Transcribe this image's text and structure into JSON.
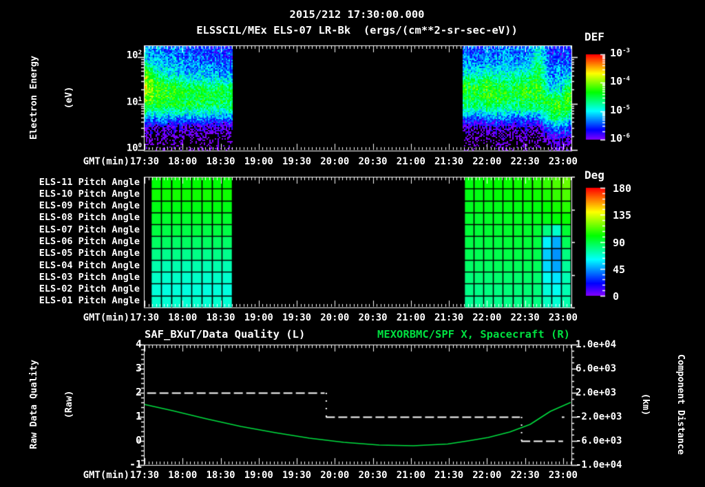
{
  "header": {
    "title": "2015/212 17:30:00.000",
    "subtitle": "ELSSCIL/MEx ELS-07 LR-Bk  (ergs/(cm**2-sr-sec-eV))"
  },
  "time_axis": {
    "label": "GMT(min)",
    "ticks": [
      "17:30",
      "18:00",
      "18:30",
      "19:00",
      "19:30",
      "20:00",
      "20:30",
      "21:00",
      "21:30",
      "22:00",
      "22:30",
      "23:00"
    ]
  },
  "colors": {
    "background": "#000000",
    "foreground": "#ffffff",
    "series_green": "#00e040"
  },
  "chart_data": [
    {
      "type": "heatmap",
      "name": "electron-energy-spectrogram",
      "title": "2015/212 17:30:00.000",
      "subtitle": "ELSSCIL/MEx ELS-07 LR-Bk  (ergs/(cm**2-sr-sec-eV))",
      "xlabel": "GMT(min)",
      "ylabel": "Electron Energy",
      "ylabel2": "(eV)",
      "y_scale": "log",
      "y_ticks": [
        "10^0",
        "10^1",
        "10^2"
      ],
      "colorbar": {
        "title": "DEF",
        "units": "ergs/(cm**2-sr-sec-eV)",
        "ticks": [
          "10^-3",
          "10^-4",
          "10^-5",
          "10^-6"
        ]
      },
      "energy_bins_log10_eV": [
        2.15,
        1.95,
        1.75,
        1.55,
        1.35,
        1.15,
        0.95,
        0.75,
        0.5,
        0.25,
        0.05
      ],
      "blocks": [
        {
          "t_start": "17:30",
          "t_end": "18:39",
          "log10_flux_rows": [
            [
              -5.2,
              -5.3,
              -5.4,
              -5.4,
              -5.5,
              -5.5,
              -5.5,
              -5.6
            ],
            [
              -5.0,
              -5.2,
              -5.3,
              -5.3,
              -5.4,
              -5.4,
              -5.4,
              -5.5
            ],
            [
              -4.4,
              -5.0,
              -5.1,
              -5.2,
              -5.2,
              -5.2,
              -5.2,
              -5.3
            ],
            [
              -3.9,
              -4.6,
              -4.8,
              -4.9,
              -5.0,
              -5.0,
              -5.0,
              -5.1
            ],
            [
              -3.85,
              -4.3,
              -4.4,
              -4.45,
              -4.5,
              -4.5,
              -4.5,
              -4.55
            ],
            [
              -4.0,
              -4.3,
              -4.35,
              -4.4,
              -4.4,
              -4.4,
              -4.45,
              -4.5
            ],
            [
              -4.4,
              -4.5,
              -4.5,
              -4.5,
              -4.5,
              -4.5,
              -4.55,
              -4.6
            ],
            [
              -5.0,
              -5.1,
              -5.1,
              -5.1,
              -5.1,
              -5.1,
              -5.1,
              -5.2
            ],
            [
              -5.9,
              -6.0,
              -6.0,
              -6.0,
              -6.0,
              -6.0,
              -6.0,
              -6.0
            ],
            [
              -6.3,
              -6.3,
              -6.3,
              -6.3,
              -6.3,
              -6.3,
              -6.3,
              -6.3
            ],
            [
              -6.4,
              -6.4,
              -6.4,
              -6.4,
              -6.4,
              -6.4,
              -6.4,
              -6.4
            ]
          ]
        },
        {
          "t_start": "21:41",
          "t_end": "23:06",
          "log10_flux_rows": [
            [
              -5.4,
              -5.4,
              -5.4,
              -5.4,
              -5.4,
              -5.4,
              -5.3,
              -5.0,
              -5.5,
              -5.6,
              -5.6
            ],
            [
              -5.3,
              -5.3,
              -5.3,
              -5.3,
              -5.3,
              -5.3,
              -5.2,
              -4.7,
              -5.4,
              -5.5,
              -5.5
            ],
            [
              -5.1,
              -5.1,
              -5.0,
              -5.1,
              -5.1,
              -5.0,
              -5.0,
              -4.5,
              -5.3,
              -5.4,
              -5.3
            ],
            [
              -4.7,
              -4.6,
              -4.5,
              -4.7,
              -4.8,
              -4.6,
              -4.6,
              -4.35,
              -5.2,
              -5.3,
              -4.9
            ],
            [
              -4.3,
              -4.25,
              -4.3,
              -4.4,
              -4.5,
              -4.4,
              -4.3,
              -4.3,
              -5.0,
              -5.1,
              -4.3
            ],
            [
              -4.35,
              -4.3,
              -4.35,
              -4.4,
              -4.5,
              -4.45,
              -4.4,
              -4.4,
              -4.4,
              -4.6,
              -4.25
            ],
            [
              -4.6,
              -4.6,
              -4.6,
              -4.6,
              -4.7,
              -4.6,
              -4.6,
              -4.7,
              -4.2,
              -4.3,
              -4.4
            ],
            [
              -5.2,
              -5.2,
              -5.2,
              -5.2,
              -5.3,
              -5.2,
              -5.2,
              -5.3,
              -4.5,
              -4.6,
              -4.9
            ],
            [
              -6.0,
              -6.0,
              -6.0,
              -6.0,
              -6.1,
              -6.0,
              -6.0,
              -6.1,
              -5.3,
              -5.4,
              -5.5
            ],
            [
              -6.3,
              -6.3,
              -6.3,
              -6.3,
              -6.3,
              -6.3,
              -6.3,
              -6.3,
              -5.9,
              -6.0,
              -6.1
            ],
            [
              -6.4,
              -6.4,
              -6.4,
              -6.4,
              -6.4,
              -6.4,
              -6.4,
              -6.4,
              -6.2,
              -6.2,
              -6.3
            ]
          ]
        }
      ]
    },
    {
      "type": "heatmap",
      "name": "pitch-angle-panel",
      "xlabel": "GMT(min)",
      "row_labels": [
        "ELS-11 Pitch Angle",
        "ELS-10 Pitch Angle",
        "ELS-09 Pitch Angle",
        "ELS-08 Pitch Angle",
        "ELS-07 Pitch Angle",
        "ELS-06 Pitch Angle",
        "ELS-05 Pitch Angle",
        "ELS-04 Pitch Angle",
        "ELS-03 Pitch Angle",
        "ELS-02 Pitch Angle",
        "ELS-01 Pitch Angle"
      ],
      "colorbar": {
        "title": "Deg",
        "ticks": [
          180,
          135,
          90,
          45,
          0
        ]
      },
      "blocks": [
        {
          "t_start": "17:35",
          "t_end": "18:39",
          "deg_rows": [
            [
              99,
              100,
              100,
              99,
              100,
              100,
              99,
              100
            ],
            [
              102,
              102,
              103,
              102,
              102,
              103,
              102,
              102
            ],
            [
              97,
              98,
              97,
              98,
              97,
              98,
              98,
              97
            ],
            [
              94,
              93,
              94,
              93,
              94,
              93,
              94,
              93
            ],
            [
              90,
              89,
              90,
              89,
              90,
              89,
              90,
              89
            ],
            [
              85,
              85,
              84,
              85,
              84,
              85,
              85,
              84
            ],
            [
              79,
              78,
              79,
              78,
              79,
              78,
              79,
              78
            ],
            [
              73,
              72,
              73,
              72,
              73,
              72,
              73,
              72
            ],
            [
              69,
              68,
              69,
              68,
              69,
              68,
              69,
              68
            ],
            [
              66,
              65,
              66,
              65,
              66,
              65,
              66,
              65
            ],
            [
              68,
              67,
              68,
              67,
              68,
              67,
              68,
              67
            ]
          ]
        },
        {
          "t_start": "21:42",
          "t_end": "23:06",
          "deg_rows": [
            [
              98,
              99,
              100,
              100,
              101,
              102,
              103,
              105,
              108,
              112,
              116
            ],
            [
              97,
              97,
              98,
              99,
              99,
              100,
              101,
              102,
              104,
              108,
              112
            ],
            [
              95,
              96,
              96,
              96,
              97,
              97,
              98,
              98,
              100,
              103,
              106
            ],
            [
              93,
              93,
              94,
              94,
              95,
              95,
              95,
              96,
              97,
              99,
              101
            ],
            [
              91,
              91,
              92,
              92,
              93,
              93,
              93,
              92,
              80,
              68,
              92
            ],
            [
              89,
              89,
              90,
              90,
              91,
              91,
              91,
              90,
              58,
              47,
              86
            ],
            [
              87,
              87,
              88,
              88,
              89,
              89,
              89,
              88,
              52,
              43,
              80
            ],
            [
              84,
              85,
              85,
              86,
              86,
              86,
              87,
              86,
              54,
              46,
              76
            ],
            [
              81,
              82,
              82,
              83,
              83,
              83,
              84,
              83,
              62,
              56,
              72
            ],
            [
              79,
              79,
              80,
              80,
              81,
              81,
              82,
              81,
              66,
              62,
              72
            ],
            [
              77,
              77,
              78,
              78,
              79,
              79,
              80,
              80,
              70,
              67,
              73
            ]
          ]
        }
      ]
    },
    {
      "type": "line",
      "name": "quality-and-spacecraft-x",
      "title_left": "SAF_BXuT/Data Quality (L)",
      "title_right": "MEXORBMC/SPF X, Spacecraft (R)",
      "xlabel": "GMT(min)",
      "left_axis": {
        "label": "Raw Data Quality",
        "label2": "(Raw)",
        "range": [
          -1,
          4
        ],
        "ticks": [
          4,
          3,
          2,
          1,
          0,
          -1
        ]
      },
      "right_axis": {
        "label": "Component Distance",
        "label2": "(km)",
        "range": [
          -10000,
          10000
        ],
        "ticks": [
          "1.0e+04",
          "6.0e+03",
          "2.0e+03",
          "-2.0e+03",
          "-6.0e+03",
          "-1.0e+04"
        ],
        "tick_values": [
          10000,
          6000,
          2000,
          -2000,
          -6000,
          -10000
        ]
      },
      "series": [
        {
          "name": "SAF_BXuT/Data Quality",
          "axis": "left",
          "style": "dashed",
          "color": "#ffffff",
          "segments": [
            {
              "start": "17:32",
              "end": "19:52",
              "value": 2
            },
            {
              "start": "19:53",
              "end": "22:26",
              "value": 1
            },
            {
              "start": "22:27",
              "end": "23:00",
              "value": 0
            },
            {
              "start": "22:59",
              "end": "23:01",
              "value": 1
            }
          ]
        },
        {
          "name": "MEXORBMC/SPF X",
          "axis": "right",
          "style": "solid",
          "color": "#00e040",
          "t_minutes": [
            0,
            22,
            49,
            76,
            103,
            130,
            157,
            185,
            212,
            239,
            255,
            271,
            288,
            304,
            320,
            336
          ],
          "km": [
            50,
            -970,
            -2340,
            -3600,
            -4630,
            -5540,
            -6230,
            -6690,
            -6800,
            -6510,
            -6000,
            -5430,
            -4510,
            -3260,
            -1090,
            400
          ]
        }
      ]
    }
  ]
}
